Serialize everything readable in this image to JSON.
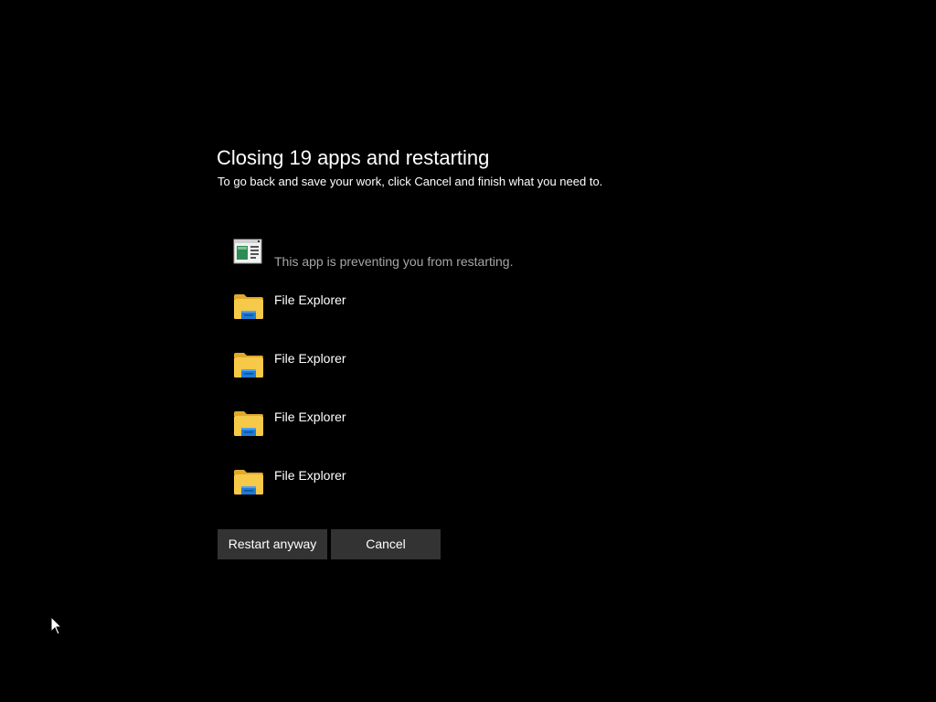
{
  "dialog": {
    "title": "Closing 19 apps and restarting",
    "subtitle": "To go back and save your work, click Cancel and finish what you need to."
  },
  "blocking_app": {
    "name": "",
    "status": "This app is preventing you from restarting.",
    "icon": "generic-app-window-icon"
  },
  "apps": [
    {
      "name": "File Explorer",
      "icon": "file-explorer-folder-icon"
    },
    {
      "name": "File Explorer",
      "icon": "file-explorer-folder-icon"
    },
    {
      "name": "File Explorer",
      "icon": "file-explorer-folder-icon"
    },
    {
      "name": "File Explorer",
      "icon": "file-explorer-folder-icon"
    }
  ],
  "buttons": {
    "restart_label": "Restart anyway",
    "cancel_label": "Cancel"
  },
  "colors": {
    "background": "#000000",
    "text": "#ffffff",
    "muted_text": "#a6a6a6",
    "button_bg": "#333333",
    "folder_yellow": "#f5c242",
    "folder_blue": "#1f7ad6"
  }
}
